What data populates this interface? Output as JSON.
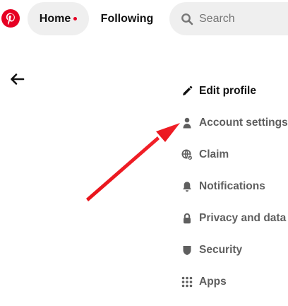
{
  "header": {
    "logo": "pinterest-logo",
    "home_label": "Home",
    "following_label": "Following",
    "search_placeholder": "Search",
    "accent_color": "#e60023"
  },
  "back_icon": "back-arrow-icon",
  "menu": {
    "items": [
      {
        "label": "Edit profile",
        "icon": "pencil-icon",
        "active": true
      },
      {
        "label": "Account settings",
        "icon": "person-icon",
        "active": false
      },
      {
        "label": "Claim",
        "icon": "globe-icon",
        "active": false
      },
      {
        "label": "Notifications",
        "icon": "bell-icon",
        "active": false
      },
      {
        "label": "Privacy and data",
        "icon": "lock-icon",
        "active": false
      },
      {
        "label": "Security",
        "icon": "shield-icon",
        "active": false
      },
      {
        "label": "Apps",
        "icon": "grid-icon",
        "active": false
      }
    ]
  },
  "annotation": {
    "type": "arrow",
    "color": "#e8141b",
    "points_to": "Account settings"
  }
}
